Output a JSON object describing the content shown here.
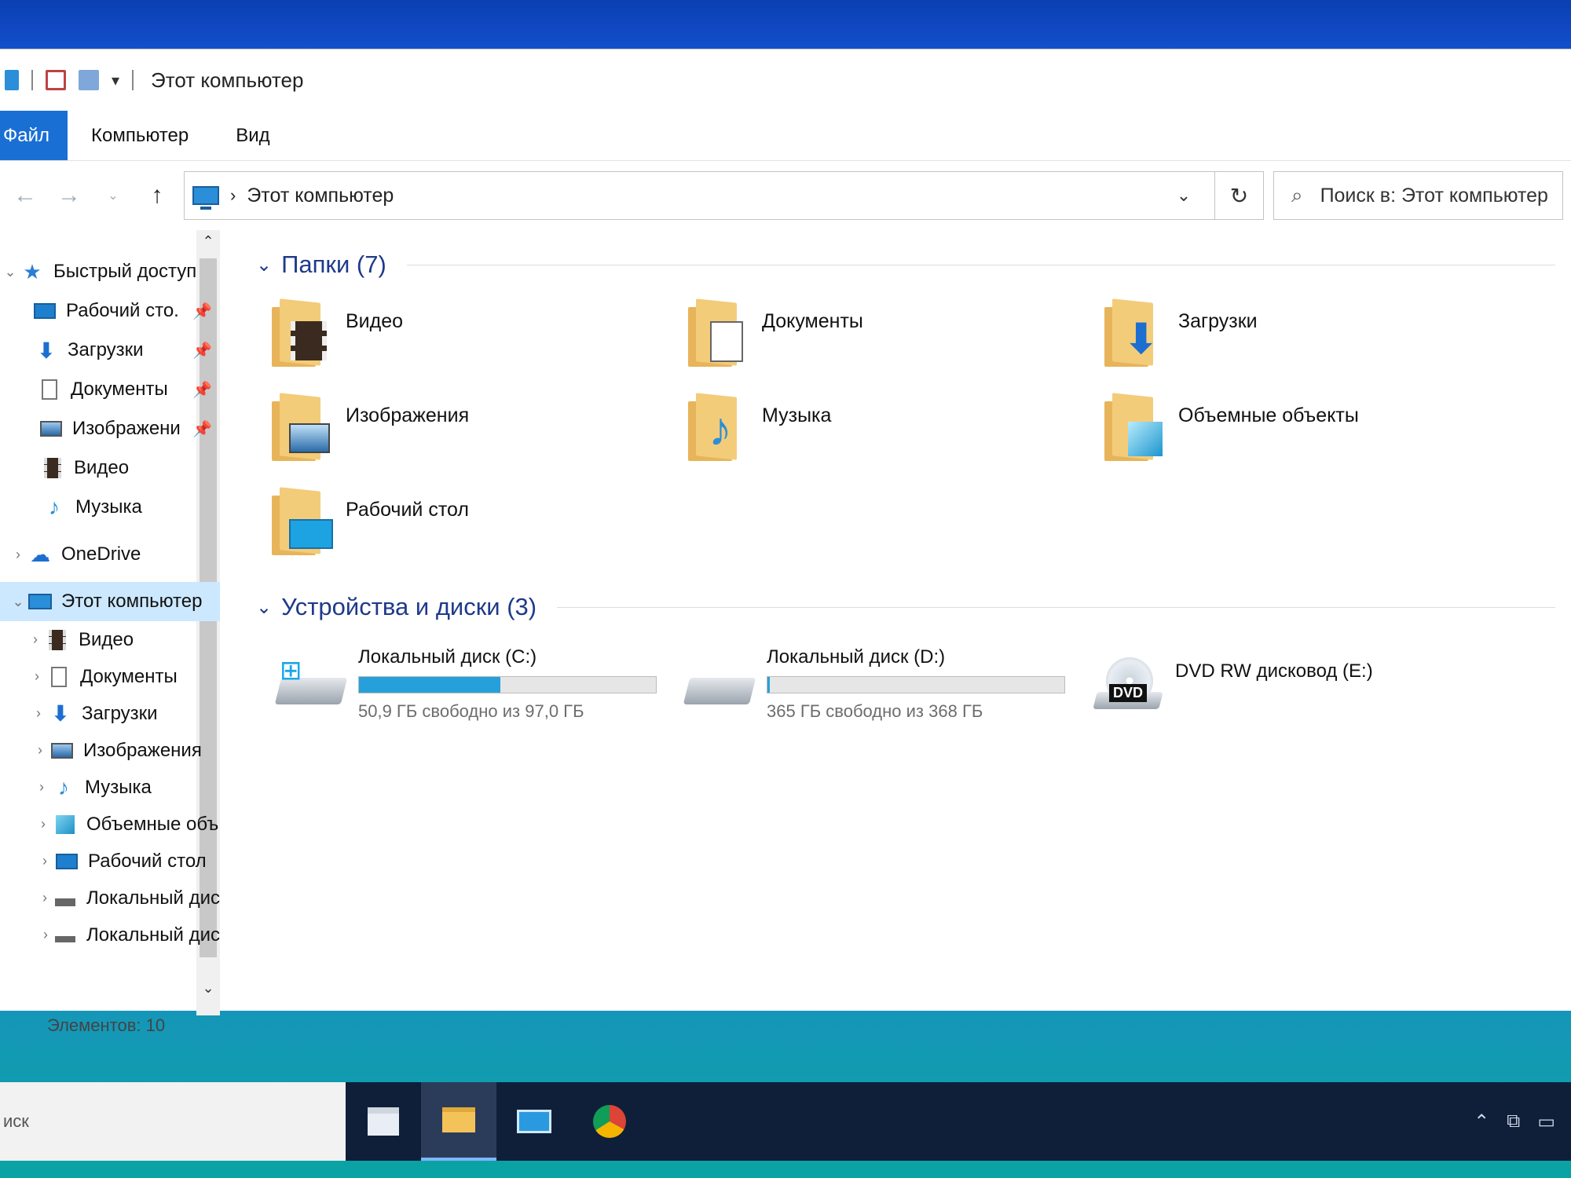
{
  "window": {
    "title": "Этот компьютер"
  },
  "ribbon": {
    "tabs": [
      "Файл",
      "Компьютер",
      "Вид"
    ]
  },
  "address": {
    "path": "Этот компьютер",
    "search_placeholder": "Поиск в: Этот компьютер"
  },
  "sidebar": {
    "items": [
      {
        "label": "Быстрый доступ",
        "icon": "star-icon",
        "pinned": false
      },
      {
        "label": "Рабочий сто.",
        "icon": "desktop-icon",
        "pinned": true
      },
      {
        "label": "Загрузки",
        "icon": "download-icon",
        "pinned": true
      },
      {
        "label": "Документы",
        "icon": "document-icon",
        "pinned": true
      },
      {
        "label": "Изображени",
        "icon": "picture-icon",
        "pinned": true
      },
      {
        "label": "Видео",
        "icon": "video-icon",
        "pinned": false
      },
      {
        "label": "Музыка",
        "icon": "music-icon",
        "pinned": false
      },
      {
        "label": "OneDrive",
        "icon": "cloud-icon",
        "pinned": false
      },
      {
        "label": "Этот компьютер",
        "icon": "computer-icon",
        "pinned": false
      },
      {
        "label": "Видео",
        "icon": "video-icon",
        "pinned": false
      },
      {
        "label": "Документы",
        "icon": "document-icon",
        "pinned": false
      },
      {
        "label": "Загрузки",
        "icon": "download-icon",
        "pinned": false
      },
      {
        "label": "Изображения",
        "icon": "picture-icon",
        "pinned": false
      },
      {
        "label": "Музыка",
        "icon": "music-icon",
        "pinned": false
      },
      {
        "label": "Объемные объ",
        "icon": "cube-icon",
        "pinned": false
      },
      {
        "label": "Рабочий стол",
        "icon": "desktop-icon",
        "pinned": false
      },
      {
        "label": "Локальный дис",
        "icon": "drive-icon",
        "pinned": false
      },
      {
        "label": "Локальный дис",
        "icon": "drive-icon",
        "pinned": false
      }
    ]
  },
  "status": {
    "items_count": "Элементов: 10"
  },
  "folders_group": {
    "header": "Папки (7)",
    "items": [
      {
        "label": "Видео",
        "icon": "video-folder-icon"
      },
      {
        "label": "Документы",
        "icon": "documents-folder-icon"
      },
      {
        "label": "Загрузки",
        "icon": "downloads-folder-icon"
      },
      {
        "label": "Изображения",
        "icon": "pictures-folder-icon"
      },
      {
        "label": "Музыка",
        "icon": "music-folder-icon"
      },
      {
        "label": "Объемные объекты",
        "icon": "3d-objects-folder-icon"
      },
      {
        "label": "Рабочий стол",
        "icon": "desktop-folder-icon"
      }
    ]
  },
  "drives_group": {
    "header": "Устройства и диски (3)",
    "items": [
      {
        "name": "Локальный диск (C:)",
        "free": "50,9 ГБ свободно из 97,0 ГБ",
        "used_fraction": 0.475,
        "icon": "system-drive-icon"
      },
      {
        "name": "Локальный диск (D:)",
        "free": "365 ГБ свободно из 368 ГБ",
        "used_fraction": 0.008,
        "icon": "hard-drive-icon"
      },
      {
        "name": "DVD RW дисковод (E:)",
        "free": "",
        "used_fraction": null,
        "icon": "dvd-drive-icon"
      }
    ]
  },
  "taskbar": {
    "search_text": "иск",
    "apps": [
      "store-icon",
      "file-explorer-icon",
      "mail-icon",
      "chrome-icon"
    ]
  },
  "colors": {
    "accent": "#1a6fd4",
    "progress": "#26a0da",
    "group_header": "#1e3a8a",
    "folder": "#f3cc7a"
  }
}
